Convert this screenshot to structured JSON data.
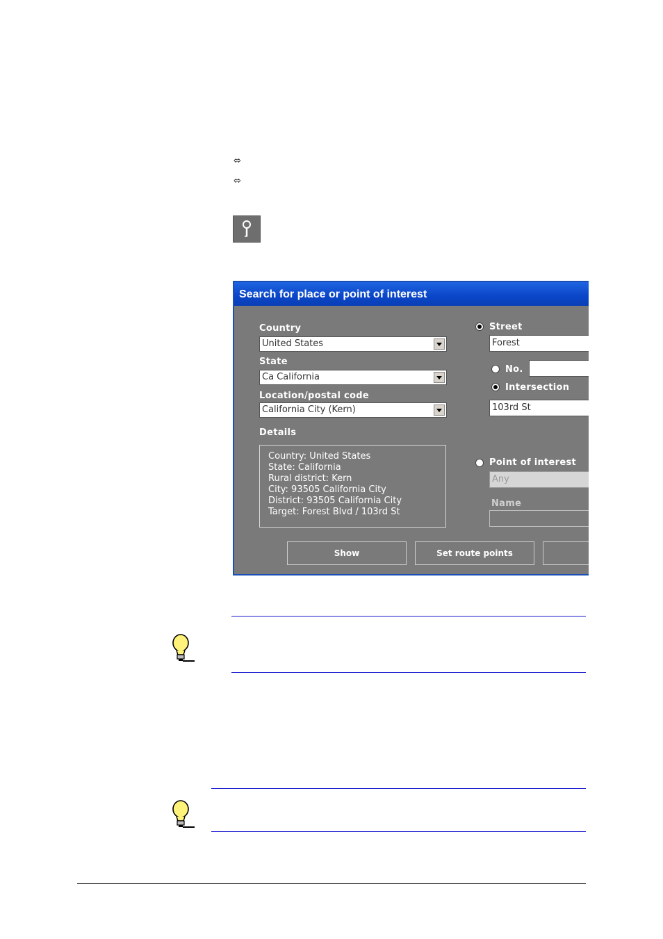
{
  "bullets": [
    "⬄",
    "⬄"
  ],
  "icons": {
    "search_button_icon": "magnifier-icon",
    "tip_icon": "lightbulb-icon"
  },
  "dialog": {
    "title": "Search for place or point of interest",
    "country_label": "Country",
    "country_value": "United States",
    "state_label": "State",
    "state_value": "Ca California",
    "location_label": "Location/postal code",
    "location_value": "California City (Kern)",
    "details_label": "Details",
    "details_lines": [
      "Country: United States",
      "State: California",
      "Rural district: Kern",
      "City: 93505 California City",
      "District: 93505 California City",
      "Target: Forest Blvd / 103rd St"
    ],
    "street_label": "Street",
    "street_value": "Forest",
    "no_label": "No.",
    "no_value": "",
    "intersection_label": "Intersection",
    "intersection_value": "103rd St",
    "poi_label": "Point of interest",
    "poi_value": "Any",
    "name_label": "Name",
    "name_value": "",
    "show_button": "Show",
    "route_button": "Set route points",
    "third_button": ""
  },
  "colors": {
    "title_bar": "#0a46c8",
    "dialog_bg": "#7a7a7a",
    "rule": "#1a1ad0"
  }
}
